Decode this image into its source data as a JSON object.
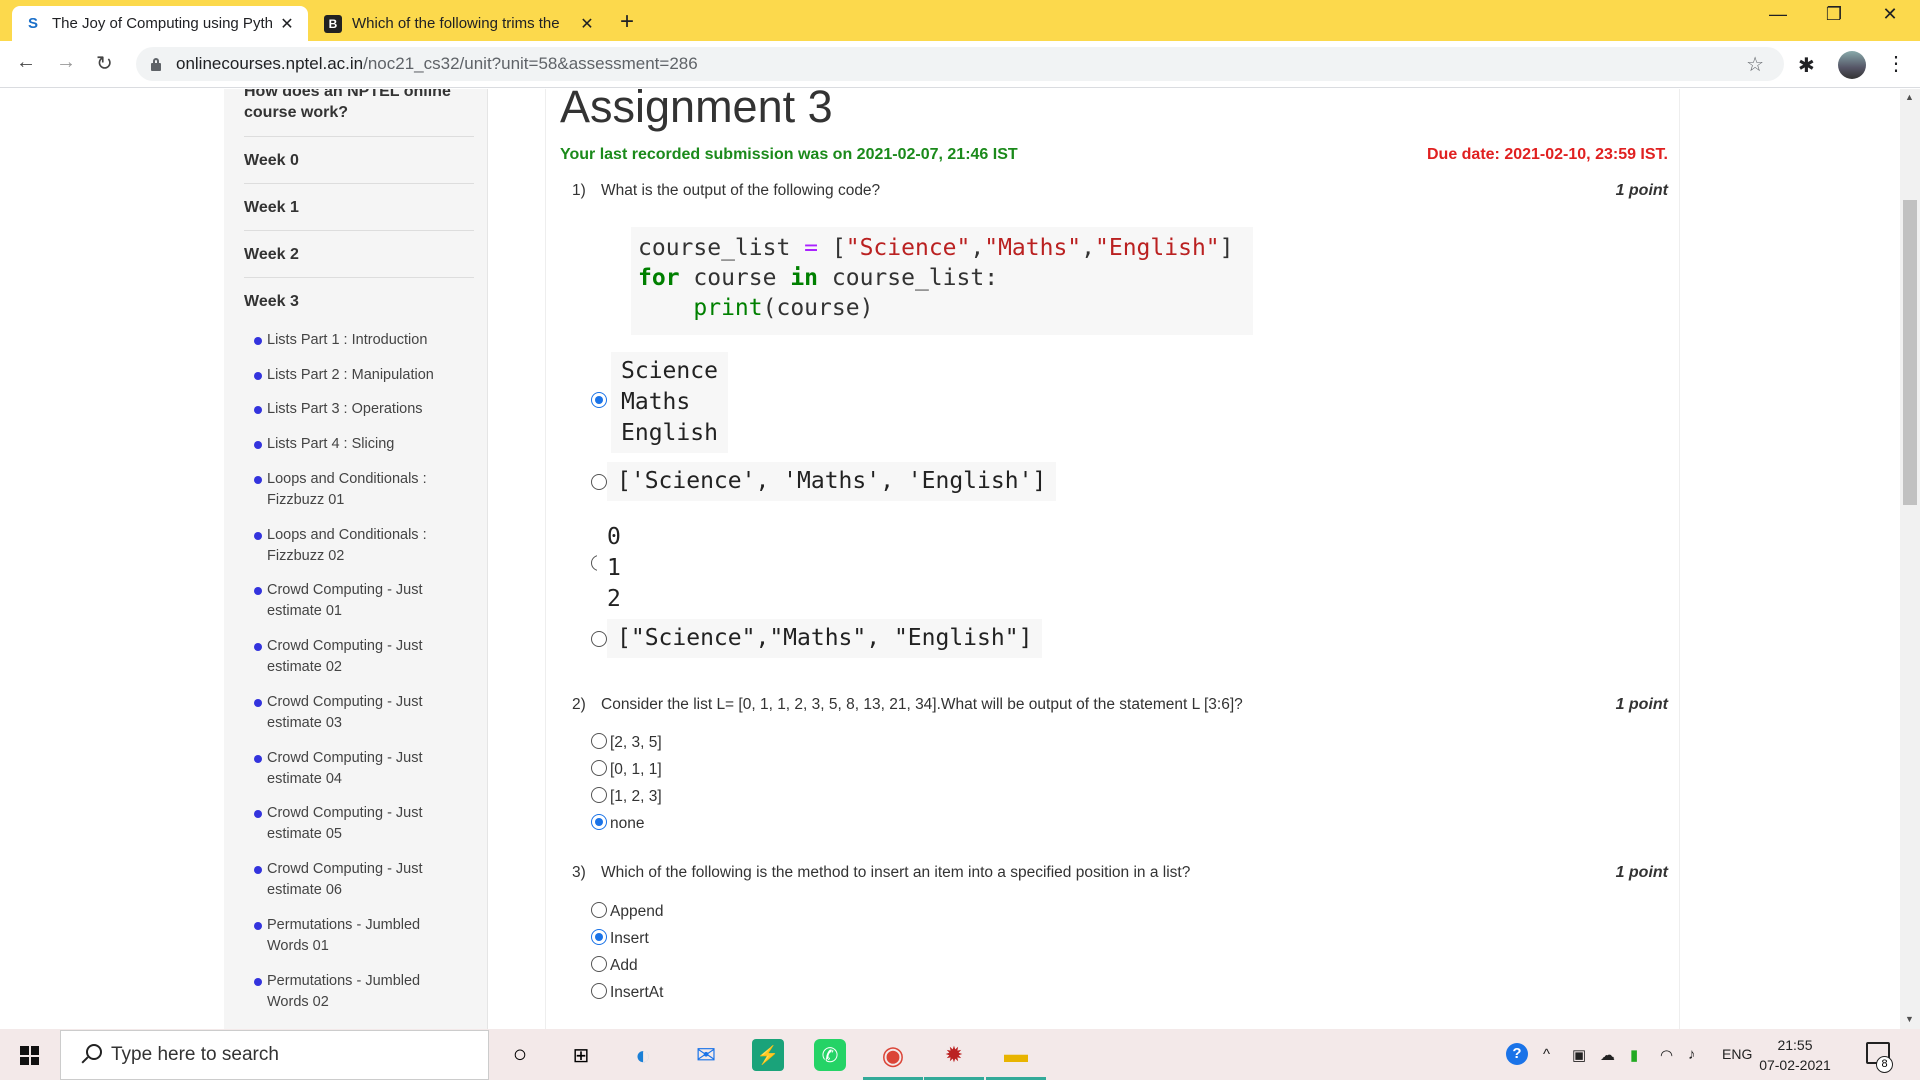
{
  "browser": {
    "tabs": [
      {
        "title": "The Joy of Computing using Pyth",
        "favicon": "S",
        "active": true
      },
      {
        "title": "Which of the following trims the",
        "favicon": "B",
        "active": false
      }
    ],
    "new_tab": "+",
    "url_host": "onlinecourses.nptel.ac.in",
    "url_path": "/noc21_cs32/unit?unit=58&assessment=286",
    "window_controls": [
      "—",
      "❐",
      "✕"
    ]
  },
  "sidebar": {
    "intro": "How does an NPTEL online course work?",
    "weeks": [
      "Week 0",
      "Week 1",
      "Week 2",
      "Week 3"
    ],
    "items": [
      "Lists Part 1 : Introduction",
      "Lists Part 2 : Manipulation",
      "Lists Part 3 : Operations",
      "Lists Part 4 : Slicing",
      "Loops and Conditionals : Fizzbuzz 01",
      "Loops and Conditionals : Fizzbuzz 02",
      "Crowd Computing - Just estimate 01",
      "Crowd Computing - Just estimate 02",
      "Crowd Computing - Just estimate 03",
      "Crowd Computing - Just estimate 04",
      "Crowd Computing - Just estimate 05",
      "Crowd Computing - Just estimate 06",
      "Permutations - Jumbled Words 01",
      "Permutations - Jumbled Words 02"
    ]
  },
  "assignment": {
    "title": "Assignment 3",
    "last_submission": "Your last recorded submission was on 2021-02-07, 21:46 IST",
    "due_date": "Due date: 2021-02-10, 23:59 IST.",
    "questions": [
      {
        "num": "1)",
        "text": "What is the output of the following code?",
        "points": "1 point",
        "code": {
          "line1_a": "course_list ",
          "line1_op": "=",
          "line1_b": " [",
          "s1": "\"Science\"",
          "s2": "\"Maths\"",
          "s3": "\"English\"",
          "line1_end": "]",
          "kw_for": "for",
          "line2_a": " course ",
          "kw_in": "in",
          "line2_b": " course_list:",
          "indent": "    ",
          "fn_print": "print",
          "line3_b": "(course)"
        },
        "options": [
          {
            "text": "Science\nMaths\nEnglish",
            "selected": true
          },
          {
            "text": "['Science', 'Maths', 'English']",
            "selected": false
          },
          {
            "text": "0\n1\n2",
            "selected": false
          },
          {
            "text": "[\"Science\",\"Maths\", \"English\"]",
            "selected": false
          }
        ]
      },
      {
        "num": "2)",
        "text": "Consider the list L= [0, 1, 1, 2, 3, 5, 8, 13, 21, 34].What will be output of the statement L [3:6]?",
        "points": "1 point",
        "options": [
          {
            "text": "[2, 3, 5]",
            "selected": false
          },
          {
            "text": "[0, 1, 1]",
            "selected": false
          },
          {
            "text": "[1, 2, 3]",
            "selected": false
          },
          {
            "text": "none",
            "selected": true
          }
        ]
      },
      {
        "num": "3)",
        "text": "Which of the following is the method to insert an item into a specified position in a list?",
        "points": "1 point",
        "options": [
          {
            "text": "Append",
            "selected": false
          },
          {
            "text": "Insert",
            "selected": true
          },
          {
            "text": "Add",
            "selected": false
          },
          {
            "text": "InsertAt",
            "selected": false
          }
        ]
      }
    ]
  },
  "taskbar": {
    "search_placeholder": "Type here to search",
    "language": "ENG",
    "time": "21:55",
    "date": "07-02-2021",
    "notification_count": "8"
  },
  "colors": {
    "tab_bar": "#fcd94c",
    "submission_green": "#1b8a1b",
    "due_red": "#e02020",
    "radio_blue": "#1a73e8"
  }
}
